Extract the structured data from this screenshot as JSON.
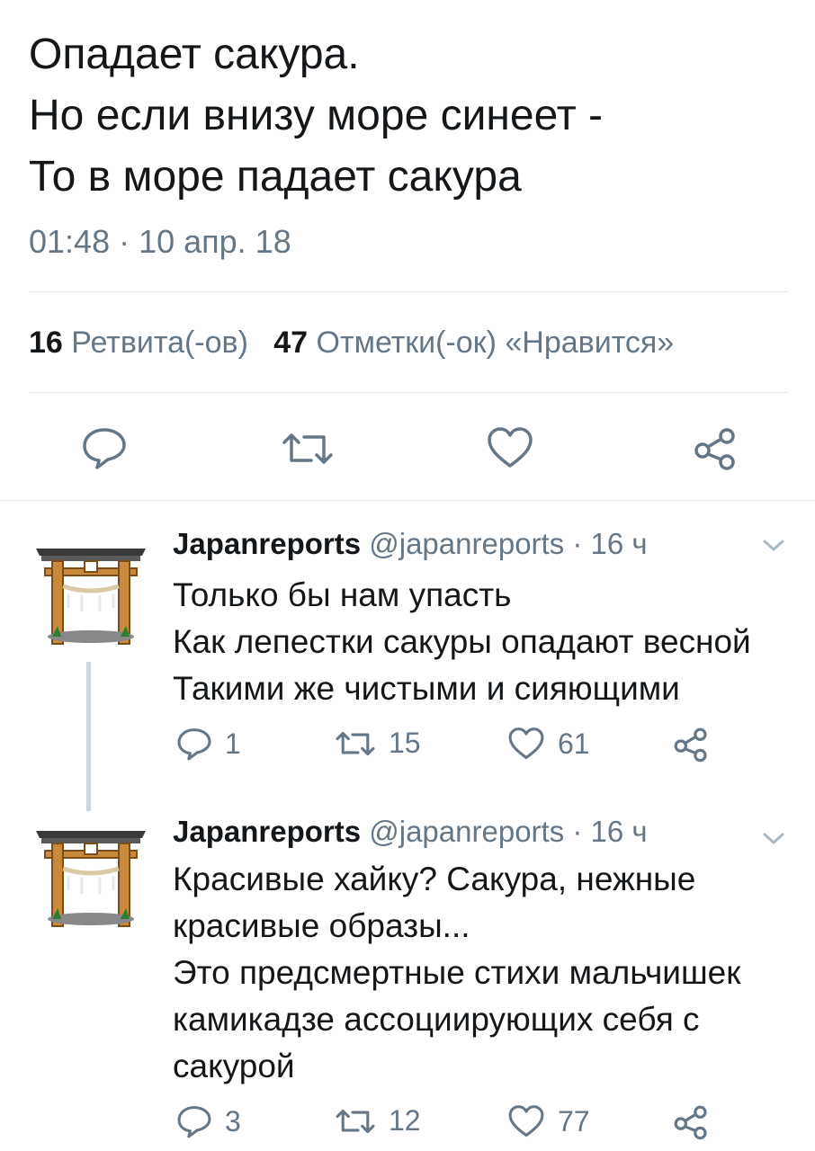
{
  "tweet": {
    "lines": [
      "Опадает сакура.",
      "Но если внизу море синеет -",
      "То в море падает сакура"
    ],
    "timestamp": "01:48 · 10 апр. 18",
    "retweet_count": "16",
    "retweet_label": "Ретвита(-ов)",
    "like_count": "47",
    "like_label": "Отметки(-ок) «Нравится»",
    "actions": [
      "reply-icon",
      "retweet-icon",
      "like-icon",
      "share-icon"
    ]
  },
  "replies": [
    {
      "name": "Japanreports",
      "handle": "@japanreports",
      "time": "· 16 ч",
      "lines": [
        "Только бы нам упасть",
        "Как лепестки сакуры опадают весной",
        "Такими же чистыми и сияющими"
      ],
      "reply_count": "1",
      "retweet_count": "15",
      "like_count": "61"
    },
    {
      "name": "Japanreports",
      "handle": "@japanreports",
      "time": "· 16 ч",
      "lines": [
        "Красивые хайку? Сакура, нежные",
        "красивые образы...",
        "Это предсмертные стихи мальчишек",
        "камикадзе ассоциирующих себя с",
        "сакурой"
      ],
      "reply_count": "3",
      "retweet_count": "12",
      "like_count": "77"
    }
  ],
  "colors": {
    "text": "#14171a",
    "muted": "#657786",
    "divider": "#e1e8ed",
    "thread": "#ccd6dd"
  }
}
